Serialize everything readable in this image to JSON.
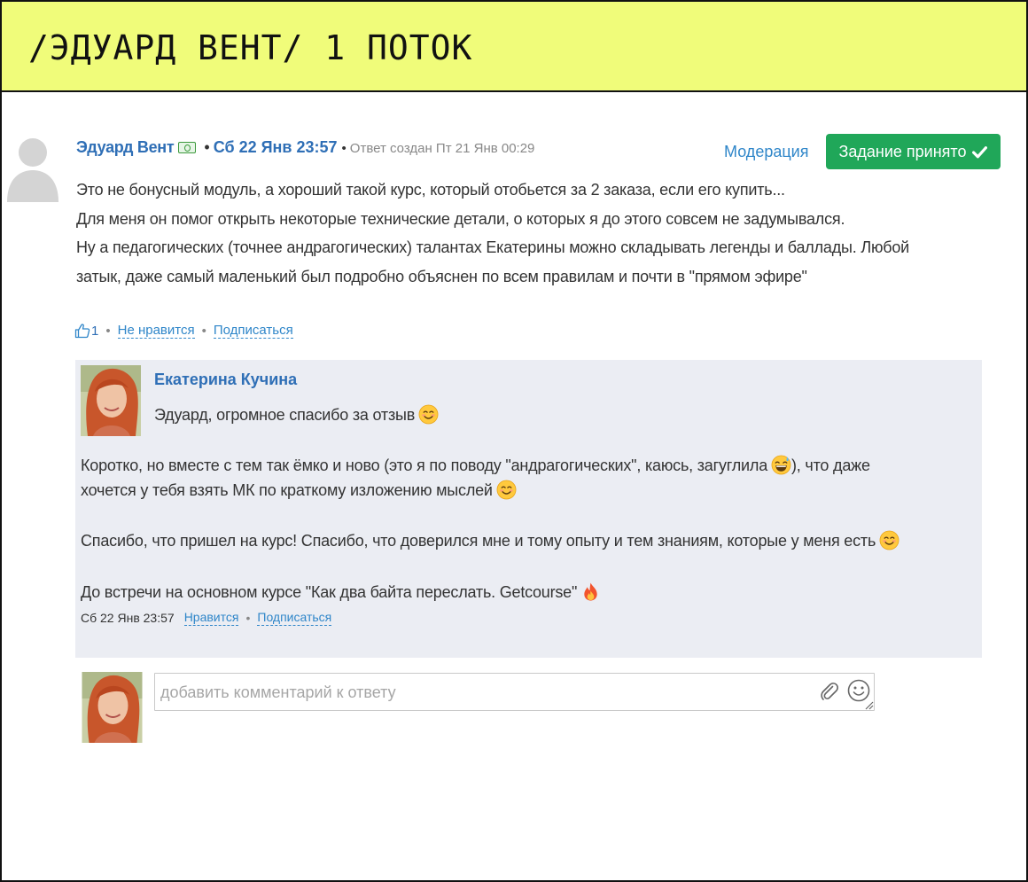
{
  "banner": {
    "title": "/ЭДУАРД ВЕНТ/ 1 ПОТОК"
  },
  "comment": {
    "author": "Эдуард Вент",
    "date": "Сб 22 Янв 23:57",
    "created_note": "Ответ создан Пт 21 Янв 00:29",
    "moderation_label": "Модерация",
    "status_button_label": "Задание принято",
    "lines": [
      "Это не бонусный модуль, а хороший такой курс, который отобьется за 2 заказа, если его купить...",
      "Для меня он помог открыть некоторые технические детали, о которых я до этого совсем не задумывался.",
      "Ну а педагогических (точнее андрагогических) талантах Екатерины можно складывать легенды и баллады. Любой",
      "затык, даже самый маленький был подробно объяснен по всем правилам и почти в \"прямом эфире\""
    ],
    "likes": "1",
    "dislike_label": "Не нравится",
    "subscribe_label": "Подписаться"
  },
  "reply": {
    "author": "Екатерина Кучина",
    "greeting": "Эдуард, огромное спасибо за отзыв",
    "p1_line1": "Коротко, но вместе с тем так ёмко и ново (это я по поводу \"андрагогических\", каюсь, загуглила",
    "p1_line1_tail": "), что даже",
    "p1_line2": "хочется у тебя взять МК по краткому изложению мыслей",
    "p2": "Спасибо, что пришел на курс! Спасибо, что доверился мне и тому опыту и тем знаниям, которые у меня есть",
    "p3": "До встречи на основном курсе \"Как два байта переслать. Getcourse\"",
    "date": "Сб 22 Янв 23:57",
    "like_label": "Нравится",
    "subscribe_label": "Подписаться"
  },
  "composer": {
    "placeholder": "добавить комментарий к ответу"
  },
  "colors": {
    "banner": "#f0fc7a",
    "accent_blue": "#2f6fb6",
    "success_green": "#20a759",
    "reply_bg": "#ebedf3"
  },
  "icons": [
    "default-avatar-icon",
    "money-icon",
    "checkmark-icon",
    "thumbs-up-icon",
    "smile-emoji-icon",
    "sweat-smile-emoji-icon",
    "fire-emoji-icon",
    "paperclip-icon",
    "emoji-picker-icon",
    "resize-handle-icon"
  ]
}
